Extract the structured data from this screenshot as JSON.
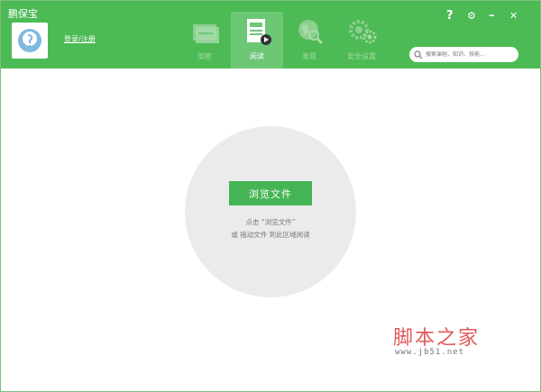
{
  "app": {
    "title": "鹏保宝"
  },
  "user": {
    "login_link": "登录/注册"
  },
  "nav": {
    "tabs": [
      {
        "label": "加密",
        "icon": "encrypt-card-icon",
        "active": false
      },
      {
        "label": "阅读",
        "icon": "reader-document-icon",
        "active": true
      },
      {
        "label": "发现",
        "icon": "globe-search-icon",
        "active": false
      },
      {
        "label": "安全设置",
        "icon": "gears-icon",
        "active": false
      }
    ]
  },
  "window_controls": {
    "help": "?",
    "settings": "⚙",
    "minimize": "–",
    "close": "✕"
  },
  "search": {
    "placeholder": "搜索课程、知识、技能..."
  },
  "main": {
    "browse_button": "浏览文件",
    "hint_line1": "点击 “浏览文件”",
    "hint_line2": "或 拖动文件 到此区域阅读"
  },
  "watermark": {
    "title": "脚本之家",
    "url": "www.jb51.net"
  },
  "colors": {
    "header": "#4cba55",
    "active_tab": "#6cc774",
    "button": "#44b454",
    "circle": "#ebebeb"
  }
}
